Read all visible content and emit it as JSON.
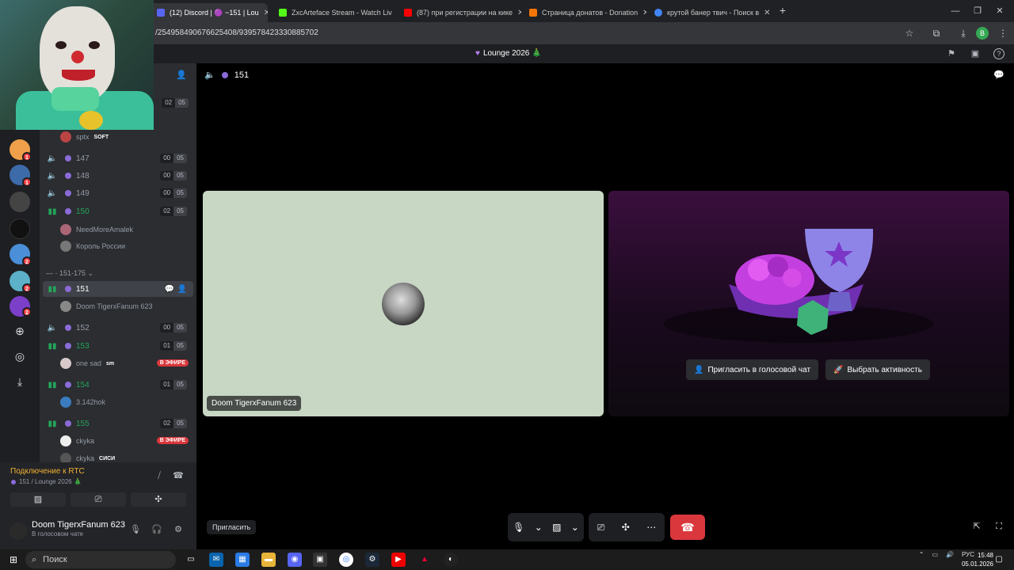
{
  "browser": {
    "tabs": [
      {
        "label": "(12) Discord | 🟣 ~151 | Lou",
        "fav": "#5865f2",
        "active": true
      },
      {
        "label": "ZxcArteface Stream - Watch Liv",
        "fav": "#53fc18",
        "active": false
      },
      {
        "label": "(87) при регистрации на кике",
        "fav": "#ff0000",
        "active": false
      },
      {
        "label": "Страница донатов - Donation",
        "fav": "#f57507",
        "active": false
      },
      {
        "label": "крутой банер твич - Поиск в",
        "fav": "#4285f4",
        "active": false
      }
    ],
    "url": "/254958490676625408/939578423330885702",
    "profile_initial": "B"
  },
  "discord": {
    "window_title": "Lounge 2026 🎄",
    "channel_header": "151",
    "category": "151-175",
    "top_item_counts": [
      "02",
      "05"
    ],
    "top_user": {
      "name": "sptx",
      "tag": "SOFT"
    },
    "channels": [
      {
        "name": "147",
        "live": false,
        "counts": [
          "00",
          "05"
        ]
      },
      {
        "name": "148",
        "live": false,
        "counts": [
          "00",
          "05"
        ]
      },
      {
        "name": "149",
        "live": false,
        "counts": [
          "00",
          "05"
        ]
      },
      {
        "name": "150",
        "live": true,
        "counts": [
          "02",
          "05"
        ],
        "users": [
          "NeedMoreAmalek",
          "Король России"
        ]
      },
      {
        "name": "151",
        "live": true,
        "active": true,
        "users": [
          "Doom TigerxFanum 623"
        ]
      },
      {
        "name": "152",
        "live": false,
        "counts": [
          "00",
          "05"
        ]
      },
      {
        "name": "153",
        "live": true,
        "counts": [
          "01",
          "05"
        ],
        "users": [
          "one sad"
        ],
        "user_tag": "sm",
        "live_badge": "В ЭФИРЕ"
      },
      {
        "name": "154",
        "live": true,
        "counts": [
          "01",
          "05"
        ],
        "users": [
          "3.142hok"
        ]
      },
      {
        "name": "155",
        "live": true,
        "counts": [
          "02",
          "05"
        ],
        "users": [
          "ckyka",
          "ckyka"
        ],
        "user_tag": "СИСИ",
        "live_badge": "В ЭФИРЕ"
      }
    ],
    "server_badges": [
      "1",
      "1",
      "2",
      "2",
      "2"
    ],
    "panel": {
      "rtc_status": "Подключение к RTC",
      "rtc_sub": "151 / Lounge 2026 🎄",
      "username": "Doom TigerxFanum 623",
      "user_status": "В голосовом чате"
    },
    "tile_user": "Doom TigerxFanum 623",
    "invite_voice": "Пригласить в голосовой чат",
    "choose_activity": "Выбрать активность",
    "invite_button": "Пригласить"
  },
  "taskbar": {
    "search_label": "Поиск",
    "lang": "РУС",
    "time": "15:48",
    "date": "05.01.2026"
  },
  "colors": {
    "live_green": "#23a55a",
    "accent_purple": "#8b6bd8",
    "hangup_red": "#da373c",
    "rtc_yellow": "#f0b232"
  }
}
